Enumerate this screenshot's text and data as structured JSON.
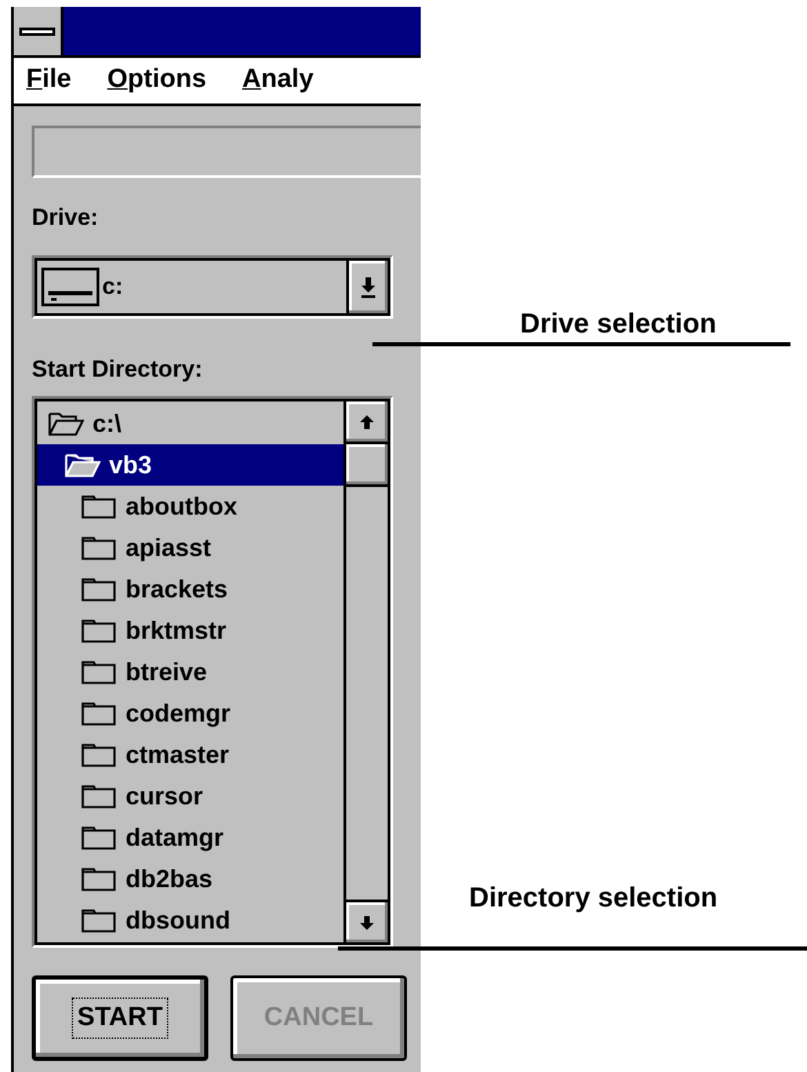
{
  "menu": [
    {
      "label": "File"
    },
    {
      "label": "Options"
    },
    {
      "label": "Analy"
    }
  ],
  "drive_label": "Drive:",
  "drive": {
    "value": "c:"
  },
  "start_directory_label": "Start Directory:",
  "directories": [
    {
      "name": "c:\\",
      "selected": false,
      "children": [
        {
          "name": "vb3",
          "selected": true,
          "children": [
            {
              "name": "aboutbox",
              "selected": false
            },
            {
              "name": "apiasst",
              "selected": false
            },
            {
              "name": "brackets",
              "selected": false
            },
            {
              "name": "brktmstr",
              "selected": false
            },
            {
              "name": "btreive",
              "selected": false
            },
            {
              "name": "codemgr",
              "selected": false
            },
            {
              "name": "ctmaster",
              "selected": false
            },
            {
              "name": "cursor",
              "selected": false
            },
            {
              "name": "datamgr",
              "selected": false
            },
            {
              "name": "db2bas",
              "selected": false
            },
            {
              "name": "dbsound",
              "selected": false
            }
          ]
        }
      ]
    }
  ],
  "buttons": [
    {
      "label": "START",
      "default": true,
      "disabled": false
    },
    {
      "label": "CANCEL",
      "default": false,
      "disabled": true
    }
  ],
  "annotations": [
    {
      "label": "Drive selection"
    },
    {
      "label": "Directory selection"
    }
  ]
}
